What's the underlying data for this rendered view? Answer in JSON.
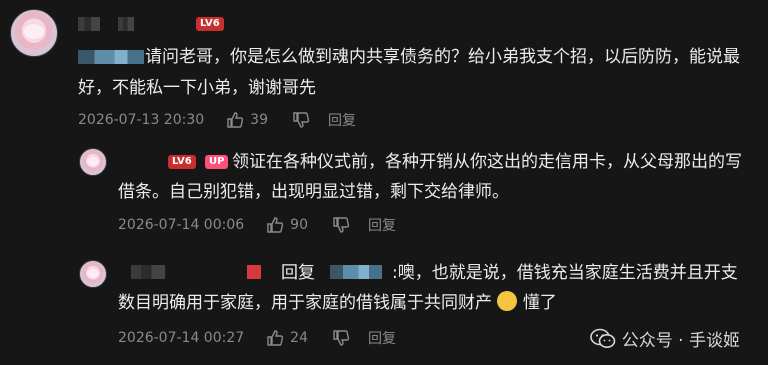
{
  "comments": [
    {
      "badge_lv": "LV6",
      "text_line1": "请问老哥，你是怎么做到魂内共享债务的？给小弟我支个招，以后防防，能说最",
      "text_line2": "好，不能私一下小弟，谢谢哥先",
      "time": "2026-07-13 20:30",
      "likes": "39",
      "reply_label": "回复"
    },
    {
      "badge_lv": "LV6",
      "badge_up": "UP",
      "text_line1": "领证在各种仪式前，各种开销从你这出的走信用卡，从父母那出的写",
      "text_line2": "借条。自己别犯错，出现明显过错，剩下交给律师。",
      "time": "2026-07-14 00:06",
      "likes": "90",
      "reply_label": "回复"
    },
    {
      "reply_prefix": "回复",
      "text_line1": ":噢，也就是说，借钱充当家庭生活费并且开支",
      "text_line2": "数目明确用于家庭，用于家庭的借钱属于共同财产",
      "text_line2_tail": "懂了",
      "time": "2026-07-14 00:27",
      "likes": "24",
      "reply_label": "回复"
    }
  ],
  "watermark": {
    "text": "公众号 · 手谈姬",
    "icon": "wechat-icon"
  },
  "colors": {
    "background": "#161616",
    "badge_lv": "#c8302f",
    "badge_up": "#ff4f7a",
    "meta": "#8a8a8a"
  }
}
